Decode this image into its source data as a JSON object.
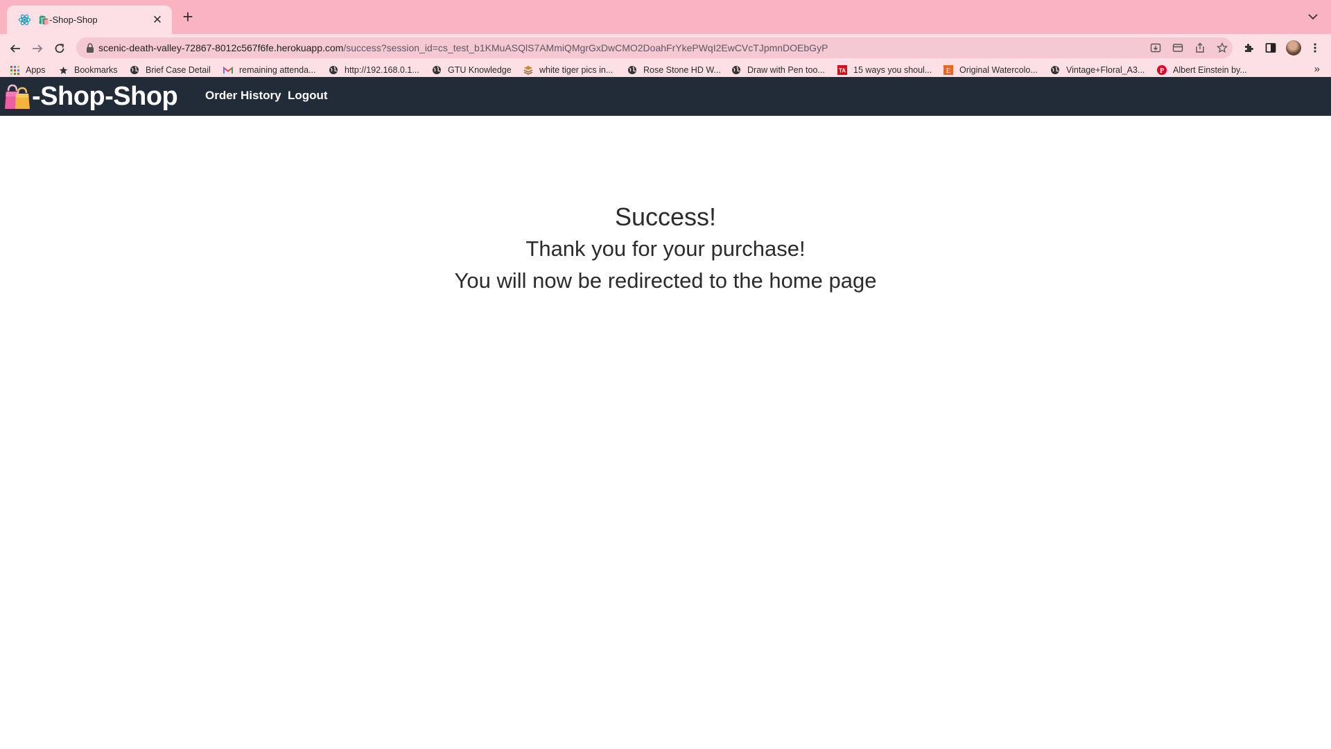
{
  "browser": {
    "tab": {
      "title": "🛍️-Shop-Shop"
    },
    "address_bar": {
      "host": "scenic-death-valley-72867-8012c567f6fe.herokuapp.com",
      "path": "/success?session_id=cs_test_b1KMuASQlS7AMmiQMgrGxDwCMO2DoahFrYkePWqI2EwCVcTJpmnDOEbGyP"
    },
    "bookmarks": [
      {
        "label": "Apps",
        "icon": "apps-grid-icon"
      },
      {
        "label": "Bookmarks",
        "icon": "star-icon"
      },
      {
        "label": "Brief Case Detail",
        "icon": "globe-icon"
      },
      {
        "label": "remaining attenda...",
        "icon": "gmail-icon"
      },
      {
        "label": "http://192.168.0.1...",
        "icon": "globe-icon"
      },
      {
        "label": "GTU Knowledge",
        "icon": "globe-icon"
      },
      {
        "label": "white tiger pics in...",
        "icon": "layers-icon"
      },
      {
        "label": "Rose Stone HD W...",
        "icon": "globe-icon"
      },
      {
        "label": "Draw with Pen too...",
        "icon": "globe-icon"
      },
      {
        "label": "15 ways you shoul...",
        "icon": "ta-icon"
      },
      {
        "label": "Original Watercolo...",
        "icon": "etsy-icon"
      },
      {
        "label": "Vintage+Floral_A3...",
        "icon": "globe-icon"
      },
      {
        "label": "Albert Einstein by...",
        "icon": "pinterest-icon"
      }
    ],
    "colors": {
      "chrome": "#f9b3c1",
      "toolbar": "#fde0e6"
    }
  },
  "app": {
    "brand": "-Shop-Shop",
    "nav": {
      "order_history": "Order History",
      "logout": "Logout"
    },
    "colors": {
      "navbar": "#222b38"
    }
  },
  "main": {
    "title": "Success!",
    "thanks": "Thank you for your purchase!",
    "redirect": "You will now be redirected to the home page"
  }
}
